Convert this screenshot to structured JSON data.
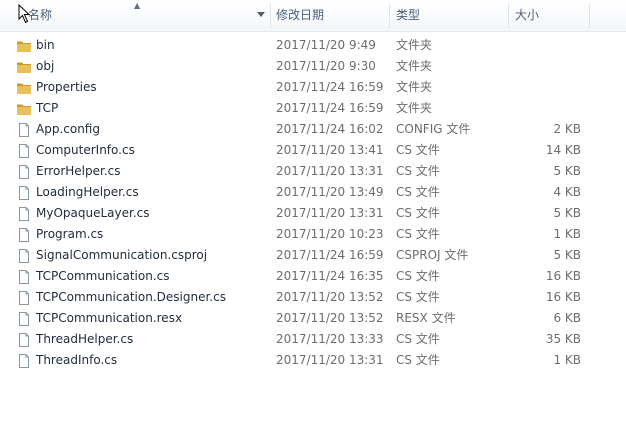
{
  "columns": {
    "name": "名称",
    "date": "修改日期",
    "type": "类型",
    "size": "大小"
  },
  "files": [
    {
      "name": "bin",
      "date": "2017/11/20 9:49",
      "type": "文件夹",
      "size": "",
      "icon": "folder-icon"
    },
    {
      "name": "obj",
      "date": "2017/11/20 9:30",
      "type": "文件夹",
      "size": "",
      "icon": "folder-icon"
    },
    {
      "name": "Properties",
      "date": "2017/11/24 16:59",
      "type": "文件夹",
      "size": "",
      "icon": "folder-icon"
    },
    {
      "name": "TCP",
      "date": "2017/11/24 16:59",
      "type": "文件夹",
      "size": "",
      "icon": "folder-icon"
    },
    {
      "name": "App.config",
      "date": "2017/11/24 16:02",
      "type": "CONFIG 文件",
      "size": "2 KB",
      "icon": "file-icon"
    },
    {
      "name": "ComputerInfo.cs",
      "date": "2017/11/20 13:41",
      "type": "CS 文件",
      "size": "14 KB",
      "icon": "file-icon"
    },
    {
      "name": "ErrorHelper.cs",
      "date": "2017/11/20 13:31",
      "type": "CS 文件",
      "size": "5 KB",
      "icon": "file-icon"
    },
    {
      "name": "LoadingHelper.cs",
      "date": "2017/11/20 13:49",
      "type": "CS 文件",
      "size": "4 KB",
      "icon": "file-icon"
    },
    {
      "name": "MyOpaqueLayer.cs",
      "date": "2017/11/20 13:31",
      "type": "CS 文件",
      "size": "5 KB",
      "icon": "file-icon"
    },
    {
      "name": "Program.cs",
      "date": "2017/11/20 10:23",
      "type": "CS 文件",
      "size": "1 KB",
      "icon": "file-icon"
    },
    {
      "name": "SignalCommunication.csproj",
      "date": "2017/11/24 16:59",
      "type": "CSPROJ 文件",
      "size": "5 KB",
      "icon": "file-icon"
    },
    {
      "name": "TCPCommunication.cs",
      "date": "2017/11/24 16:35",
      "type": "CS 文件",
      "size": "16 KB",
      "icon": "file-icon"
    },
    {
      "name": "TCPCommunication.Designer.cs",
      "date": "2017/11/20 13:52",
      "type": "CS 文件",
      "size": "16 KB",
      "icon": "file-icon"
    },
    {
      "name": "TCPCommunication.resx",
      "date": "2017/11/20 13:52",
      "type": "RESX 文件",
      "size": "6 KB",
      "icon": "file-icon"
    },
    {
      "name": "ThreadHelper.cs",
      "date": "2017/11/20 13:33",
      "type": "CS 文件",
      "size": "35 KB",
      "icon": "file-icon"
    },
    {
      "name": "ThreadInfo.cs",
      "date": "2017/11/20 13:31",
      "type": "CS 文件",
      "size": "1 KB",
      "icon": "file-icon"
    }
  ],
  "colors": {
    "folder": "#e8c15a",
    "folder_dark": "#c99a2e",
    "file_border": "#8a96a8"
  }
}
